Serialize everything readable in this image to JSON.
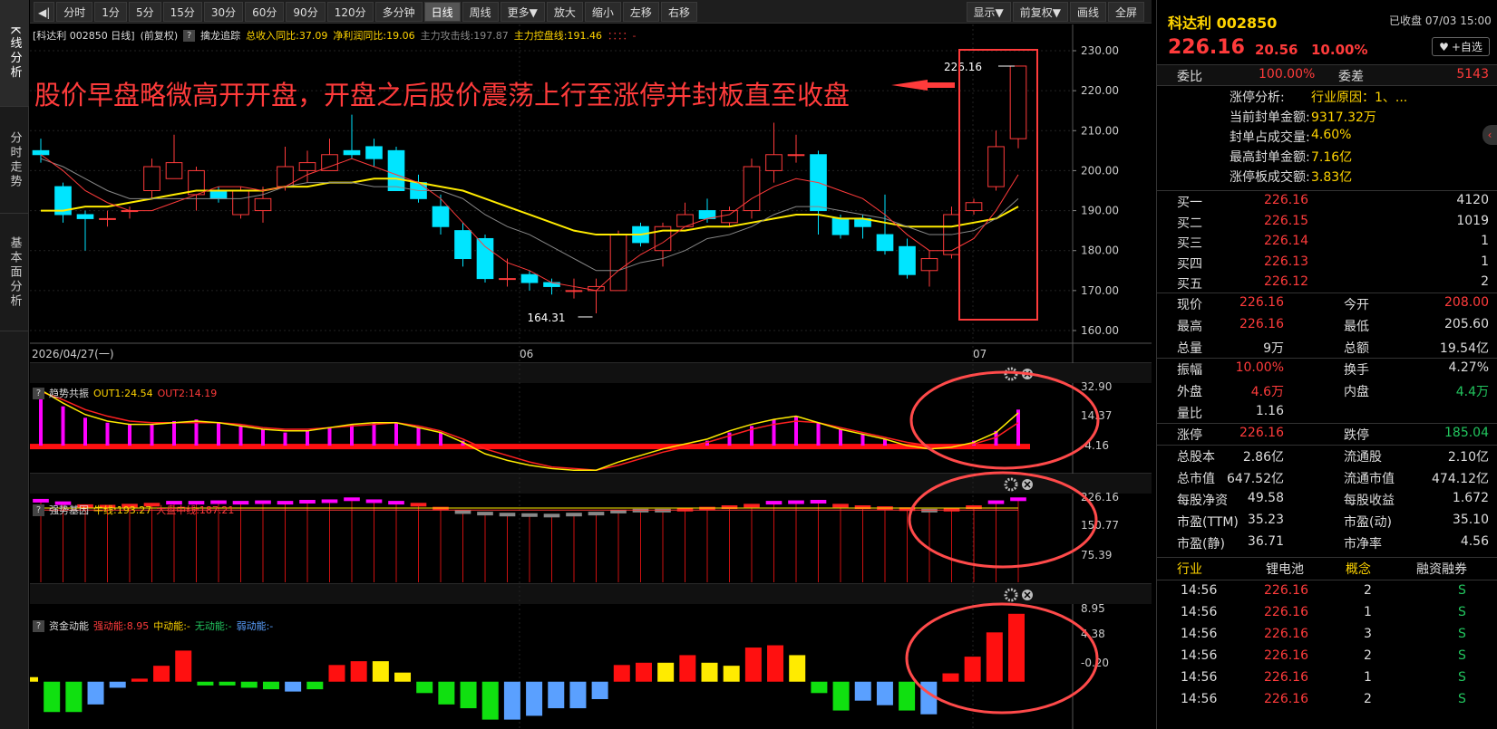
{
  "side_tabs": [
    {
      "label": "K线分析",
      "active": true
    },
    {
      "label": "分时走势",
      "active": false
    },
    {
      "label": "基本面分析",
      "active": false
    }
  ],
  "toolbar": {
    "left": [
      "分时",
      "1分",
      "5分",
      "15分",
      "30分",
      "60分",
      "90分",
      "120分",
      "多分钟",
      "日线",
      "周线",
      "更多▼",
      "放大",
      "缩小",
      "左移",
      "右移"
    ],
    "active": "日线",
    "right": [
      "显示▼",
      "前复权▼",
      "画线",
      "全屏"
    ]
  },
  "info_bar": {
    "name": "[科达利 002850 日线]",
    "adj": "(前复权)",
    "q": "?",
    "indicator": "擒龙追踪",
    "rev": "总收入同比:37.09",
    "profit": "净利润同比:19.06",
    "attack": "主力攻击线:197.87",
    "control": "主力控盘线:191.46",
    "tail": "：：：：-"
  },
  "annotation": "股价早盘略微高开开盘，开盘之后股价震荡上行至涨停并封板直至收盘",
  "price_labels": {
    "high": "226.16",
    "low": "164.31"
  },
  "date_axis": {
    "start": "2026/04/27(一)",
    "m1": "06",
    "m2": "07"
  },
  "main_axis": [
    "230.00",
    "220.00",
    "210.00",
    "200.00",
    "190.00",
    "180.00",
    "170.00",
    "160.00"
  ],
  "panel1": {
    "title": "趋势共振",
    "out1": "OUT1:24.54",
    "out2": "OUT2:14.19",
    "axis": [
      "32.90",
      "14.37",
      "-4.16"
    ]
  },
  "panel2": {
    "title": "强势基因",
    "bull": "牛线:193.27",
    "mid": "大盘中线:187.21",
    "axis": [
      "226.16",
      "150.77",
      "75.39"
    ]
  },
  "panel3": {
    "title": "资金动能",
    "strong": "强动能:8.95",
    "med": "中动能:-",
    "none": "无动能:-",
    "weak": "弱动能:-",
    "axis": [
      "8.95",
      "4.38",
      "-0.20"
    ]
  },
  "quote": {
    "name": "科达利 002850",
    "status": "已收盘 07/03 15:00",
    "price": "226.16",
    "change": "20.56",
    "pct": "10.00%",
    "fav": "+自选",
    "ratio_l": "委比",
    "ratio_v": "100.00%",
    "diff_l": "委差",
    "diff_v": "5143",
    "limit": [
      {
        "l": "涨停分析:",
        "v": "行业原因：1、..."
      },
      {
        "l": "当前封单金额:",
        "v": "9317.32万"
      },
      {
        "l": "封单占成交量:",
        "v": "4.60%"
      },
      {
        "l": "最高封单金额:",
        "v": "7.16亿"
      },
      {
        "l": "涨停板成交额:",
        "v": "3.83亿"
      }
    ],
    "bids": [
      {
        "l": "买一",
        "p": "226.16",
        "v": "4120"
      },
      {
        "l": "买二",
        "p": "226.15",
        "v": "1019"
      },
      {
        "l": "买三",
        "p": "226.14",
        "v": "1"
      },
      {
        "l": "买四",
        "p": "226.13",
        "v": "1"
      },
      {
        "l": "买五",
        "p": "226.12",
        "v": "2"
      }
    ],
    "stats": [
      {
        "l1": "现价",
        "v1": "226.16",
        "c1": "red",
        "l2": "今开",
        "v2": "208.00",
        "c2": "red"
      },
      {
        "l1": "最高",
        "v1": "226.16",
        "c1": "red",
        "l2": "最低",
        "v2": "205.60",
        "c2": "white"
      },
      {
        "l1": "总量",
        "v1": "9万",
        "c1": "white",
        "l2": "总额",
        "v2": "19.54亿",
        "c2": "white"
      },
      {
        "l1": "振幅",
        "v1": "10.00%",
        "c1": "red",
        "l2": "换手",
        "v2": "4.27%",
        "c2": "white"
      },
      {
        "l1": "外盘",
        "v1": "4.6万",
        "c1": "red",
        "l2": "内盘",
        "v2": "4.4万",
        "c2": "green"
      },
      {
        "l1": "量比",
        "v1": "1.16",
        "c1": "white",
        "l2": "",
        "v2": "",
        "c2": "white"
      },
      {
        "l1": "涨停",
        "v1": "226.16",
        "c1": "red",
        "l2": "跌停",
        "v2": "185.04",
        "c2": "green"
      },
      {
        "l1": "总股本",
        "v1": "2.86亿",
        "c1": "white",
        "l2": "流通股",
        "v2": "2.10亿",
        "c2": "white"
      },
      {
        "l1": "总市值",
        "v1": "647.52亿",
        "c1": "white",
        "l2": "流通市值",
        "v2": "474.12亿",
        "c2": "white"
      },
      {
        "l1": "每股净资",
        "v1": "49.58",
        "c1": "white",
        "l2": "每股收益",
        "v2": "1.672",
        "c2": "white"
      },
      {
        "l1": "市盈(TTM)",
        "v1": "35.23",
        "c1": "white",
        "l2": "市盈(动)",
        "v2": "35.10",
        "c2": "white"
      },
      {
        "l1": "市盈(静)",
        "v1": "36.71",
        "c1": "white",
        "l2": "市净率",
        "v2": "4.56",
        "c2": "white"
      }
    ],
    "tags": {
      "industry_l": "行业",
      "industry_v": "锂电池",
      "concept_l": "概念",
      "margin_l": "融资融券"
    },
    "trades": [
      {
        "t": "14:56",
        "p": "226.16",
        "v": "2",
        "s": "S"
      },
      {
        "t": "14:56",
        "p": "226.16",
        "v": "1",
        "s": "S"
      },
      {
        "t": "14:56",
        "p": "226.16",
        "v": "3",
        "s": "S"
      },
      {
        "t": "14:56",
        "p": "226.16",
        "v": "2",
        "s": "S"
      },
      {
        "t": "14:56",
        "p": "226.16",
        "v": "1",
        "s": "S"
      },
      {
        "t": "14:56",
        "p": "226.16",
        "v": "2",
        "s": "S"
      }
    ]
  },
  "chart_data": {
    "type": "candlestick",
    "candles": [
      [
        205,
        204,
        208,
        202
      ],
      [
        196,
        189,
        197,
        187
      ],
      [
        189,
        188,
        190,
        180
      ],
      [
        188,
        188,
        190,
        186
      ],
      [
        190,
        190,
        191,
        188
      ],
      [
        195,
        201,
        203,
        193
      ],
      [
        198,
        202,
        209,
        198
      ],
      [
        194,
        200,
        201,
        190
      ],
      [
        195,
        193,
        196,
        192
      ],
      [
        189,
        195,
        196,
        188
      ],
      [
        190,
        193,
        196,
        187
      ],
      [
        196,
        201,
        206,
        195
      ],
      [
        200,
        202,
        205,
        197
      ],
      [
        200,
        204,
        208,
        200
      ],
      [
        205,
        204,
        214,
        203
      ],
      [
        206,
        203,
        208,
        201
      ],
      [
        205,
        195,
        206,
        195
      ],
      [
        197,
        193,
        199,
        192
      ],
      [
        191,
        186,
        194,
        184
      ],
      [
        185,
        178,
        187,
        176
      ],
      [
        183,
        173,
        184,
        172
      ],
      [
        173,
        173,
        178,
        171
      ],
      [
        174,
        172,
        175,
        170
      ],
      [
        172,
        171,
        173,
        169
      ],
      [
        170,
        170,
        173,
        168
      ],
      [
        170,
        171,
        173,
        164.31
      ],
      [
        170,
        184,
        185,
        170
      ],
      [
        186,
        182,
        187,
        181
      ],
      [
        180,
        186,
        187,
        176
      ],
      [
        186,
        189,
        192,
        186
      ],
      [
        190,
        188,
        193,
        187
      ],
      [
        187,
        190,
        191,
        186
      ],
      [
        190,
        201,
        203,
        188
      ],
      [
        200,
        204,
        212,
        197
      ],
      [
        204,
        204,
        209,
        202
      ],
      [
        204,
        190,
        205,
        184
      ],
      [
        188,
        184,
        189,
        183
      ],
      [
        188,
        186,
        189,
        183
      ],
      [
        184,
        180,
        194,
        179
      ],
      [
        181,
        174,
        183,
        173
      ],
      [
        175,
        178,
        180,
        171
      ],
      [
        179,
        189,
        191,
        178
      ],
      [
        190,
        192,
        193,
        189
      ],
      [
        196,
        206,
        210,
        195
      ],
      [
        208,
        226.16,
        226.16,
        205.6
      ]
    ],
    "ma5": [
      204,
      200,
      195,
      192,
      190,
      190,
      192,
      194,
      196,
      196,
      195,
      196,
      199,
      201,
      203,
      201,
      199,
      197,
      193,
      187,
      181,
      177,
      175,
      172,
      171,
      170,
      175,
      179,
      182,
      186,
      188,
      189,
      193,
      196,
      198,
      197,
      195,
      193,
      189,
      184,
      180,
      180,
      183,
      190,
      199
    ],
    "ma10": [
      203,
      201,
      198,
      195,
      193,
      193,
      193,
      193,
      193,
      193,
      194,
      196,
      197,
      197,
      197,
      196,
      196,
      195,
      195,
      193,
      189,
      186,
      184,
      181,
      178,
      175,
      175,
      177,
      178,
      180,
      183,
      184,
      186,
      189,
      191,
      191,
      190,
      189,
      188,
      186,
      184,
      184,
      185,
      188,
      193
    ],
    "ma20": [
      190,
      190,
      191,
      191,
      192,
      193,
      194,
      195,
      195,
      195,
      195,
      196,
      196,
      197,
      197,
      198,
      198,
      197,
      196,
      195,
      193,
      191,
      189,
      187,
      185,
      184,
      184,
      184,
      185,
      185,
      186,
      186,
      187,
      188,
      189,
      189,
      188,
      188,
      187,
      186,
      186,
      186,
      187,
      188,
      191
    ],
    "osc_bars": [
      34,
      24,
      17,
      14,
      13,
      13,
      15,
      16,
      14,
      12,
      10,
      8,
      9,
      11,
      13,
      14,
      14,
      11,
      8,
      3,
      0,
      0,
      0,
      0,
      0,
      0,
      0,
      0,
      0,
      0,
      3,
      8,
      12,
      16,
      18,
      14,
      10,
      7,
      4,
      0,
      0,
      0,
      3,
      9,
      22
    ],
    "osc_line1": [
      34,
      26,
      19,
      15,
      13,
      13,
      14,
      15,
      14,
      12,
      10,
      9,
      9,
      11,
      13,
      14,
      14,
      11,
      8,
      2,
      -5,
      -9,
      -12,
      -14,
      -15,
      -15,
      -10,
      -6,
      -2,
      1,
      4,
      9,
      13,
      16,
      18,
      14,
      10,
      7,
      4,
      0,
      -2,
      -1,
      2,
      8,
      20
    ],
    "osc_line2": [
      33,
      28,
      22,
      18,
      15,
      14,
      14,
      14,
      14,
      13,
      11,
      10,
      10,
      11,
      12,
      13,
      14,
      12,
      9,
      4,
      -2,
      -6,
      -10,
      -13,
      -14,
      -15,
      -12,
      -8,
      -4,
      -1,
      2,
      6,
      10,
      13,
      15,
      14,
      11,
      8,
      5,
      2,
      0,
      0,
      1,
      5,
      14
    ],
    "gene_bars": [
      223,
      218,
      212,
      211,
      213,
      215,
      219,
      219,
      220,
      219,
      220,
      219,
      221,
      222,
      226,
      222,
      219,
      215,
      207,
      200,
      197,
      195,
      194,
      193,
      195,
      197,
      201,
      203,
      203,
      205,
      207,
      210,
      213,
      219,
      220,
      221,
      213,
      210,
      208,
      206,
      203,
      205,
      210,
      220,
      226
    ],
    "gene_line1": [
      210,
      210,
      210,
      210,
      210,
      210,
      210,
      210,
      210,
      210,
      210,
      210,
      210,
      210,
      210,
      210,
      210,
      210,
      210,
      210,
      210,
      210,
      210,
      210,
      210,
      210,
      210,
      210,
      210,
      210,
      210,
      210,
      210,
      210,
      210,
      210,
      210,
      210,
      210,
      210,
      210,
      210,
      210,
      210,
      210
    ],
    "gene_line2": [
      206,
      206,
      206,
      206,
      206,
      206,
      206,
      206,
      206,
      206,
      206,
      206,
      206,
      206,
      206,
      206,
      206,
      206,
      206,
      206,
      206,
      206,
      206,
      206,
      206,
      206,
      206,
      206,
      206,
      206,
      206,
      206,
      206,
      206,
      206,
      206,
      206,
      206,
      206,
      206,
      206,
      206,
      206,
      206,
      206
    ],
    "flow": [
      0.6,
      -4,
      -4,
      -3,
      -0.8,
      0.4,
      2.1,
      4.1,
      -0.5,
      -0.5,
      -0.8,
      -1,
      -1.3,
      -1,
      2.2,
      2.7,
      2.7,
      1.2,
      -1.5,
      -3,
      -3.5,
      -5,
      -5,
      -4.5,
      -3.5,
      -3.5,
      -2.3,
      2.2,
      2.5,
      2.5,
      3.5,
      2.5,
      2.1,
      4.5,
      4.8,
      3.5,
      -1.5,
      -3.8,
      -2.5,
      -3.1,
      -3.8,
      -4.3,
      1.1,
      3.3,
      6.5,
      8.95
    ],
    "flow_colors": [
      "yellow",
      "green",
      "green",
      "blue",
      "blue",
      "red",
      "red",
      "red",
      "green",
      "green",
      "green",
      "green",
      "blue",
      "green",
      "red",
      "red",
      "yellow",
      "yellow",
      "green",
      "green",
      "green",
      "green",
      "blue",
      "blue",
      "blue",
      "blue",
      "blue",
      "red",
      "red",
      "yellow",
      "red",
      "yellow",
      "yellow",
      "red",
      "red",
      "yellow",
      "green",
      "green",
      "blue",
      "blue",
      "green",
      "blue",
      "red",
      "red",
      "red",
      "red"
    ],
    "price_range": [
      160,
      230
    ]
  }
}
